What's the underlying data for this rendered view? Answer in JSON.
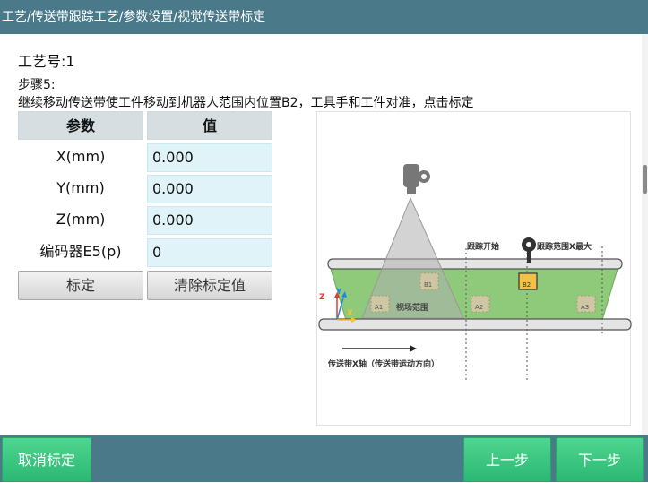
{
  "header": {
    "breadcrumb": "工艺/传送带跟踪工艺/参数设置/视觉传送带标定"
  },
  "process": {
    "label": "工艺号:1"
  },
  "step": {
    "title": "步骤5:",
    "description": "继续移动传送带使工件移动到机器人范围内位置B2，工具手和工件对准，点击标定"
  },
  "table": {
    "headers": [
      "参数",
      "值"
    ],
    "rows": [
      {
        "param": "X(mm)",
        "value": "0.000"
      },
      {
        "param": "Y(mm)",
        "value": "0.000"
      },
      {
        "param": "Z(mm)",
        "value": "0.000"
      },
      {
        "param": "编码器E5(p)",
        "value": "0"
      }
    ]
  },
  "buttons": {
    "calibrate": "标定",
    "clear": "清除标定值",
    "cancel": "取消标定",
    "prev": "上一步",
    "next": "下一步"
  },
  "diagram": {
    "labels": {
      "tracking_start": "跟踪开始",
      "tracking_xmax": "跟踪范围X最大",
      "view_range": "视场范围",
      "axis_desc": "传送带X轴（传送带运动方向）",
      "z": "Z",
      "y": "Y",
      "x": "X",
      "a1": "A1",
      "a2": "A2",
      "a3": "A3",
      "b1": "B1",
      "b2": "B2"
    },
    "icons": [
      "camera-icon",
      "pin-icon"
    ]
  }
}
